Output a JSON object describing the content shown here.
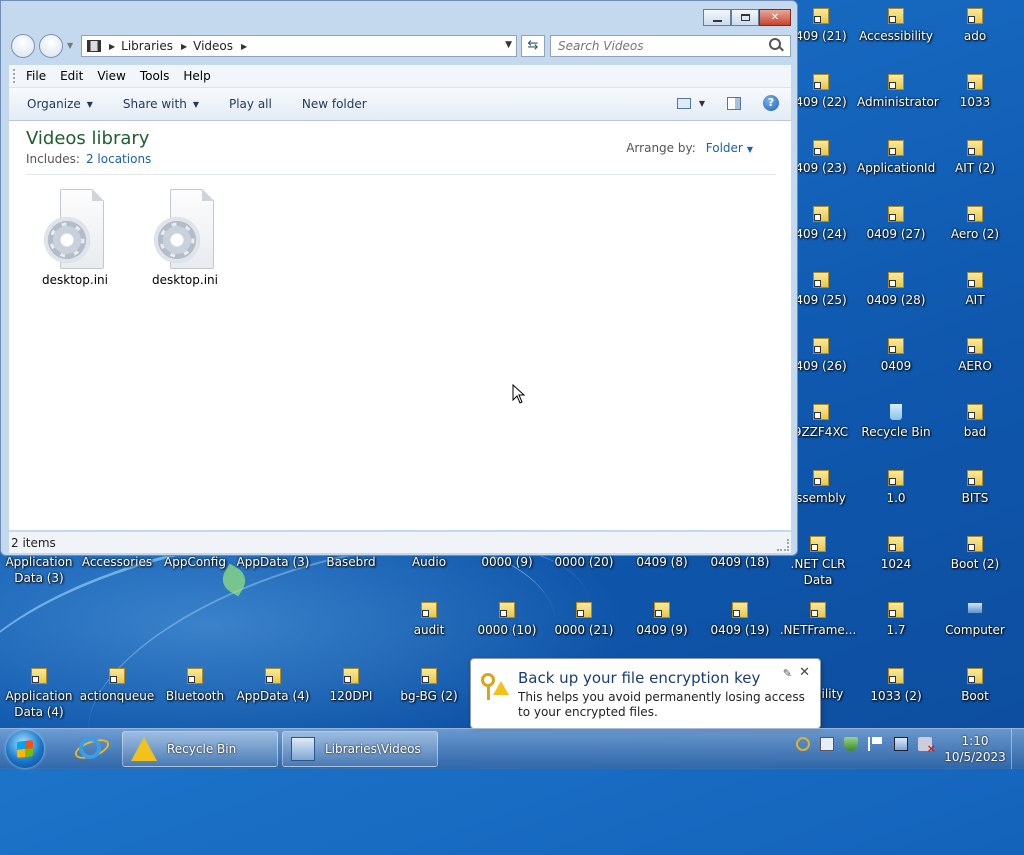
{
  "desktop": {
    "icons": [
      {
        "label": "409 (21)",
        "type": "shortcut"
      },
      {
        "label": "Accessibility",
        "type": "shortcut"
      },
      {
        "label": "ado",
        "type": "shortcut"
      },
      {
        "label": "409 (22)",
        "type": "shortcut"
      },
      {
        "label": "Administrator",
        "type": "shortcut"
      },
      {
        "label": "1033",
        "type": "shortcut"
      },
      {
        "label": "409 (23)",
        "type": "shortcut"
      },
      {
        "label": "ApplicationId",
        "type": "shortcut"
      },
      {
        "label": "AIT (2)",
        "type": "shortcut"
      },
      {
        "label": "409 (24)",
        "type": "shortcut"
      },
      {
        "label": "0409 (27)",
        "type": "shortcut"
      },
      {
        "label": "Aero (2)",
        "type": "shortcut"
      },
      {
        "label": "409 (25)",
        "type": "shortcut"
      },
      {
        "label": "0409 (28)",
        "type": "shortcut"
      },
      {
        "label": "AIT",
        "type": "shortcut"
      },
      {
        "label": "409 (26)",
        "type": "shortcut"
      },
      {
        "label": "0409",
        "type": "shortcut"
      },
      {
        "label": "AERO",
        "type": "shortcut"
      },
      {
        "label": "9ZZF4XC",
        "type": "shortcut"
      },
      {
        "label": "Recycle Bin",
        "type": "recycle-bin"
      },
      {
        "label": "bad",
        "type": "shortcut"
      },
      {
        "label": "ssembly",
        "type": "shortcut"
      },
      {
        "label": "1.0",
        "type": "shortcut"
      },
      {
        "label": "BITS",
        "type": "shortcut"
      },
      {
        "label": "Application Data (3)",
        "type": "shortcut"
      },
      {
        "label": "Accessories",
        "type": "shortcut"
      },
      {
        "label": "AppConfig",
        "type": "shortcut"
      },
      {
        "label": "AppData (3)",
        "type": "shortcut"
      },
      {
        "label": "Basebrd",
        "type": "shortcut"
      },
      {
        "label": "Audio",
        "type": "shortcut"
      },
      {
        "label": "0000 (9)",
        "type": "shortcut"
      },
      {
        "label": "0000 (20)",
        "type": "shortcut"
      },
      {
        "label": "0409 (8)",
        "type": "shortcut"
      },
      {
        "label": "0409 (18)",
        "type": "shortcut"
      },
      {
        "label": ".NET CLR Data",
        "type": "shortcut"
      },
      {
        "label": "1024",
        "type": "shortcut"
      },
      {
        "label": "Boot (2)",
        "type": "shortcut"
      },
      {
        "label": "audit",
        "type": "shortcut"
      },
      {
        "label": "0000 (10)",
        "type": "shortcut"
      },
      {
        "label": "0000 (21)",
        "type": "shortcut"
      },
      {
        "label": "0409 (9)",
        "type": "shortcut"
      },
      {
        "label": "0409 (19)",
        "type": "shortcut"
      },
      {
        "label": ".NETFrame...",
        "type": "shortcut"
      },
      {
        "label": "1.7",
        "type": "shortcut"
      },
      {
        "label": "Computer",
        "type": "computer"
      },
      {
        "label": "Application Data (4)",
        "type": "shortcut"
      },
      {
        "label": "actionqueue",
        "type": "shortcut"
      },
      {
        "label": "Bluetooth",
        "type": "shortcut"
      },
      {
        "label": "AppData (4)",
        "type": "shortcut"
      },
      {
        "label": "120DPI",
        "type": "shortcut"
      },
      {
        "label": "bg-BG (2)",
        "type": "shortcut"
      },
      {
        "label": "ibility",
        "type": "shortcut"
      },
      {
        "label": "1033 (2)",
        "type": "shortcut"
      },
      {
        "label": "Boot",
        "type": "shortcut"
      }
    ]
  },
  "explorer": {
    "address": {
      "segments": [
        "Libraries",
        "Videos"
      ]
    },
    "search": {
      "placeholder": "Search Videos"
    },
    "menu": {
      "file": "File",
      "edit": "Edit",
      "view": "View",
      "tools": "Tools",
      "help": "Help"
    },
    "commands": {
      "organize": "Organize",
      "share_with": "Share with",
      "play_all": "Play all",
      "new_folder": "New folder"
    },
    "library": {
      "title": "Videos library",
      "includes_label": "Includes:",
      "includes_link": "2 locations",
      "arrange_label": "Arrange by:",
      "arrange_value": "Folder"
    },
    "files": [
      {
        "name": "desktop.ini",
        "icon": "settings-file-icon"
      },
      {
        "name": "desktop.ini",
        "icon": "settings-file-icon"
      }
    ],
    "status": "2 items"
  },
  "notification": {
    "title": "Back up your file encryption key",
    "body": "This helps you avoid permanently losing access to your encrypted files."
  },
  "taskbar": {
    "tasks": [
      {
        "label": "Recycle Bin",
        "icon": "warning-icon"
      },
      {
        "label": "Libraries\\Videos",
        "icon": "library-icon"
      }
    ],
    "clock": {
      "time": "1:10",
      "date": "10/5/2023"
    }
  },
  "colors": {
    "accent": "#1a5fb4",
    "library_title": "#1e5e2f",
    "close_button": "#c7432c"
  }
}
